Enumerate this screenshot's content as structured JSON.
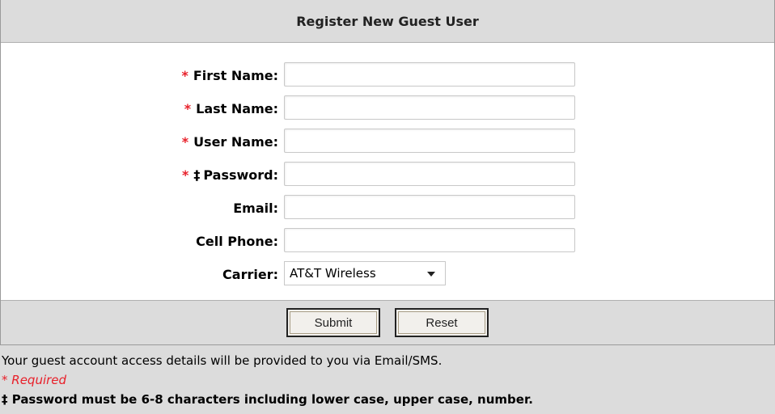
{
  "header": {
    "title": "Register New Guest User"
  },
  "form": {
    "required_marker": "*",
    "dagger_marker": "‡",
    "first_name": {
      "label": "First Name:",
      "value": "",
      "required": true
    },
    "last_name": {
      "label": "Last Name:",
      "value": "",
      "required": true
    },
    "user_name": {
      "label": "User Name:",
      "value": "",
      "required": true
    },
    "password": {
      "label": "Password:",
      "value": "",
      "required": true
    },
    "email": {
      "label": "Email:",
      "value": ""
    },
    "cell_phone": {
      "label": "Cell Phone:",
      "value": ""
    },
    "carrier": {
      "label": "Carrier:",
      "selected": "AT&T Wireless"
    }
  },
  "actions": {
    "submit_label": "Submit",
    "reset_label": "Reset"
  },
  "notes": {
    "info": "Your guest account access details will be provided to you via Email/SMS.",
    "required": "* Required",
    "password_rule": "‡ Password must be 6-8 characters including lower case, upper case, number."
  },
  "colors": {
    "required": "#e8202a",
    "header_bg": "#dcdcdc"
  }
}
